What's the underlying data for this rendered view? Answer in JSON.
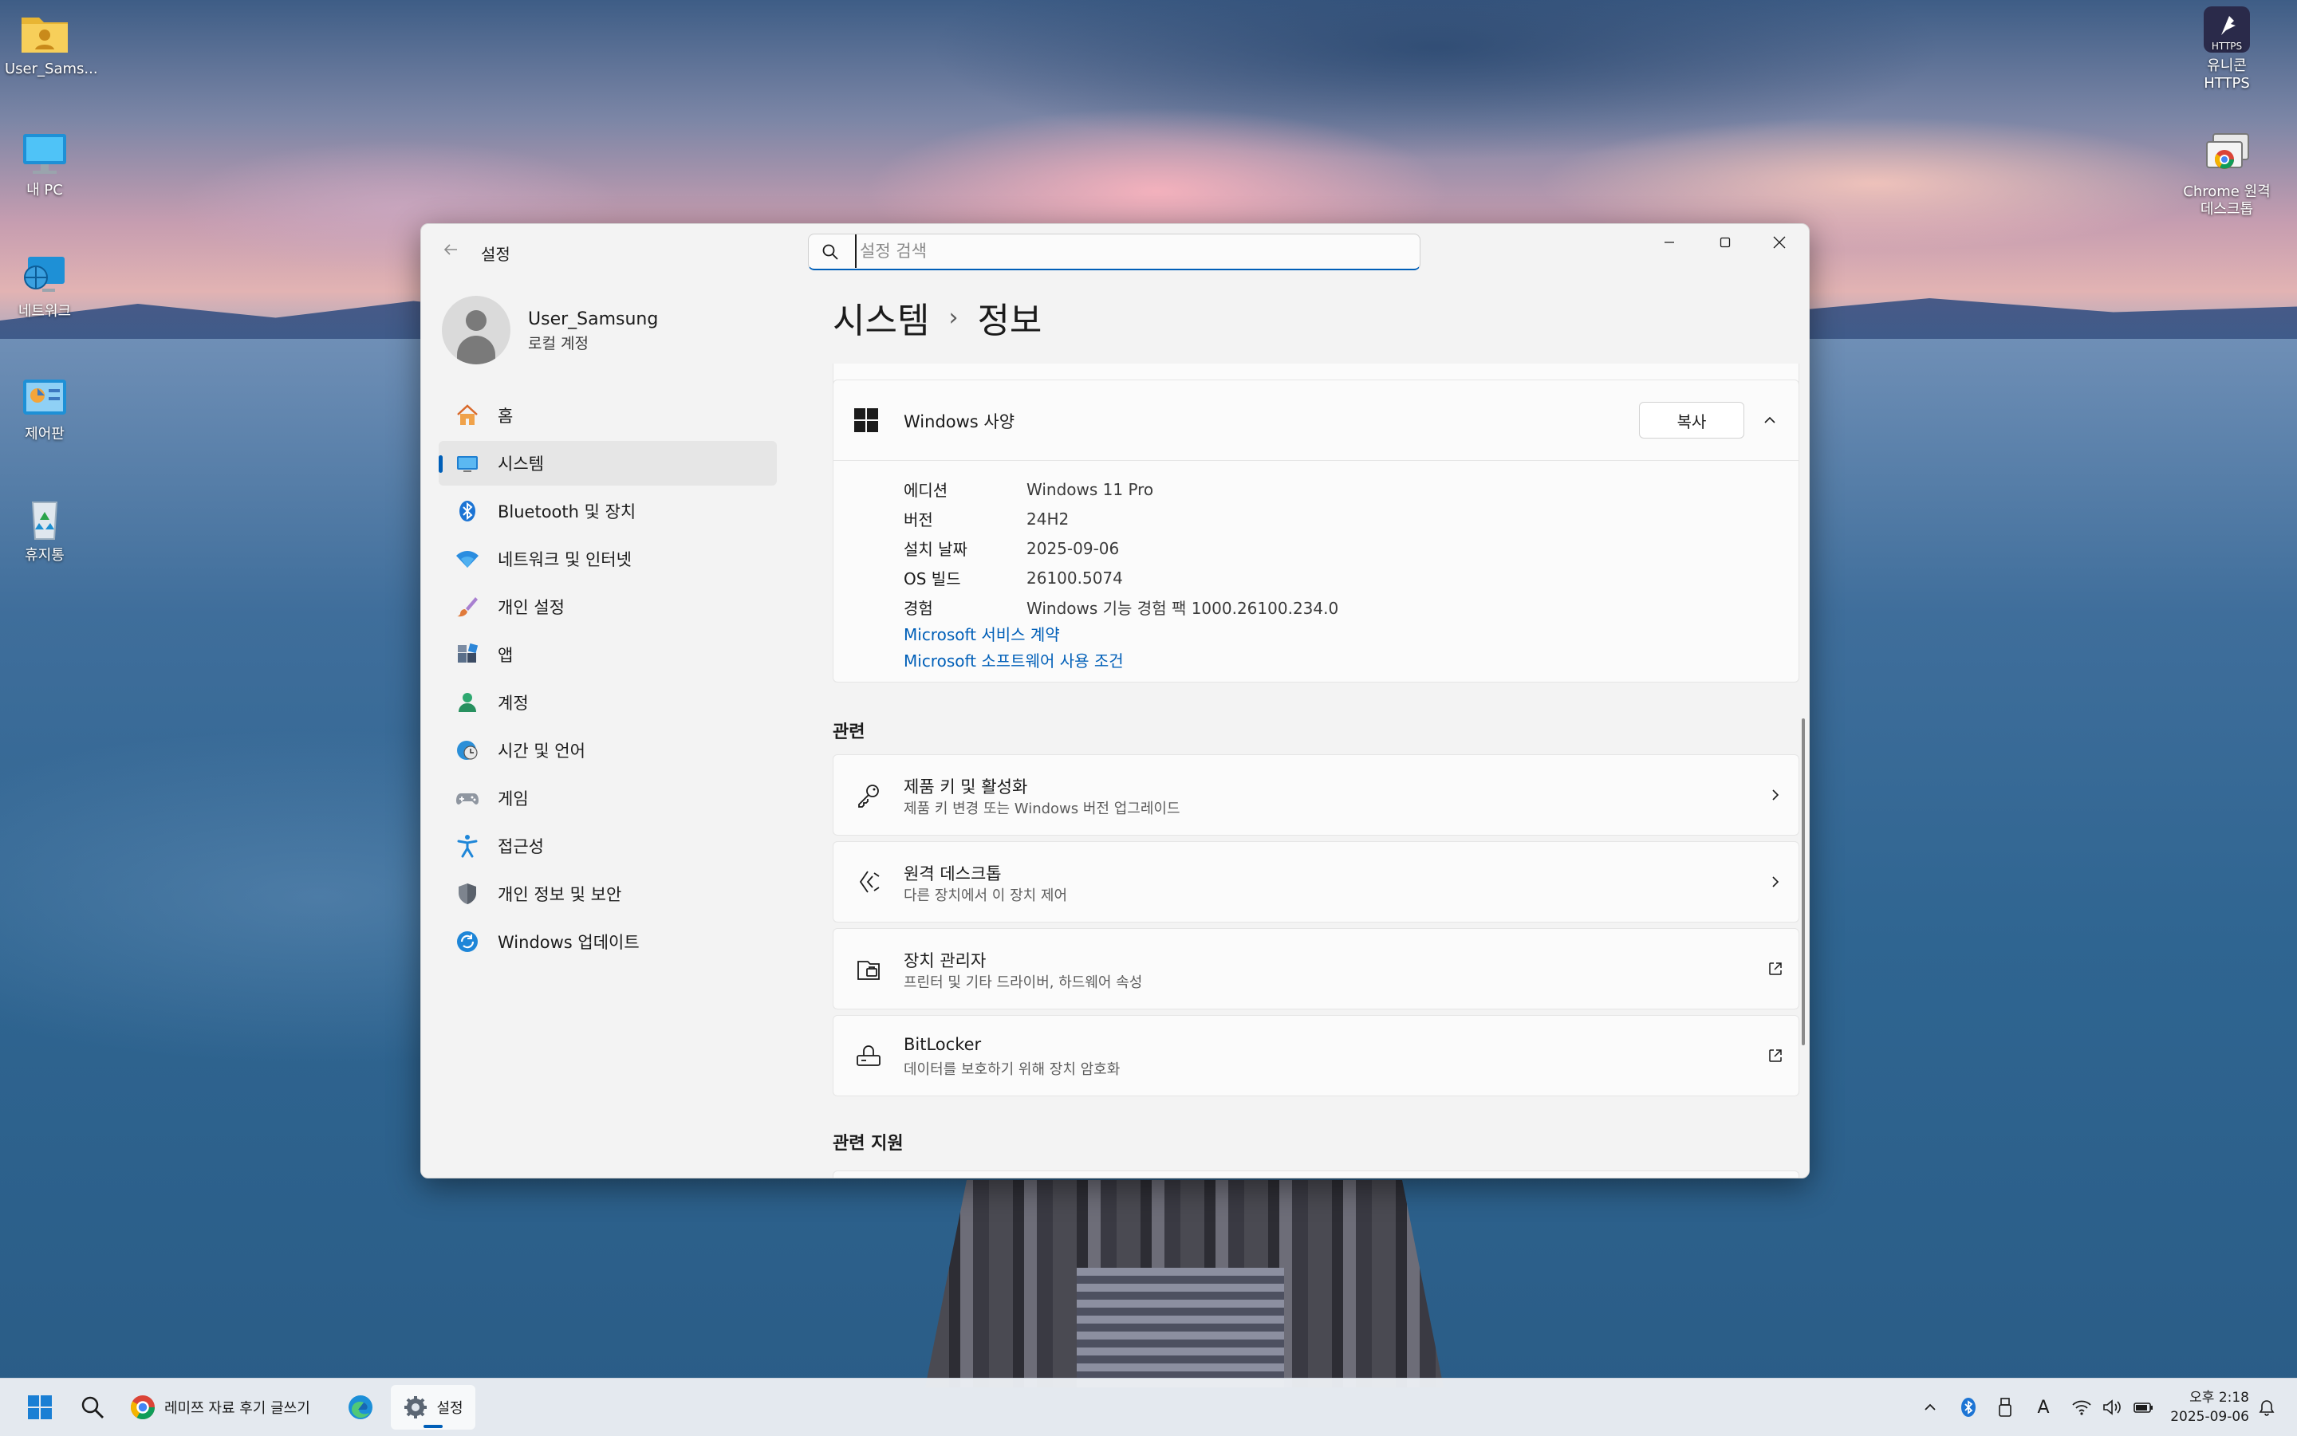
{
  "desktop": {
    "icons_left": [
      {
        "label": "User_Sams..."
      },
      {
        "label": "내 PC"
      },
      {
        "label": "네트워크"
      },
      {
        "label": "제어판"
      },
      {
        "label": "휴지통"
      }
    ],
    "icons_right": [
      {
        "label": "유니콘 HTTPS",
        "badge": "HTTPS"
      },
      {
        "label": "Chrome 원격 데스크톱"
      }
    ]
  },
  "window": {
    "app_title": "설정",
    "search_placeholder": "설정 검색",
    "controls": [
      "minimize",
      "maximize",
      "close"
    ]
  },
  "profile": {
    "name": "User_Samsung",
    "account_type": "로컬 계정"
  },
  "nav": {
    "items": [
      {
        "label": "홈",
        "icon": "home-icon"
      },
      {
        "label": "시스템",
        "icon": "system-icon",
        "selected": true
      },
      {
        "label": "Bluetooth 및 장치",
        "icon": "bluetooth-icon"
      },
      {
        "label": "네트워크 및 인터넷",
        "icon": "wifi-icon"
      },
      {
        "label": "개인 설정",
        "icon": "brush-icon"
      },
      {
        "label": "앱",
        "icon": "apps-icon"
      },
      {
        "label": "계정",
        "icon": "account-icon"
      },
      {
        "label": "시간 및 언어",
        "icon": "time-language-icon"
      },
      {
        "label": "게임",
        "icon": "gamepad-icon"
      },
      {
        "label": "접근성",
        "icon": "accessibility-icon"
      },
      {
        "label": "개인 정보 및 보안",
        "icon": "shield-icon"
      },
      {
        "label": "Windows 업데이트",
        "icon": "update-icon"
      }
    ]
  },
  "breadcrumb": {
    "parent": "시스템",
    "separator": "›",
    "current": "정보"
  },
  "windows_spec": {
    "title": "Windows 사양",
    "copy_label": "복사",
    "rows": [
      {
        "key": "에디션",
        "value": "Windows 11 Pro"
      },
      {
        "key": "버전",
        "value": "24H2"
      },
      {
        "key": "설치 날짜",
        "value": "2025-09-06"
      },
      {
        "key": "OS 빌드",
        "value": "26100.5074"
      },
      {
        "key": "경험",
        "value": "Windows 기능 경험 팩 1000.26100.234.0"
      }
    ],
    "links": [
      "Microsoft 서비스 계약",
      "Microsoft 소프트웨어 사용 조건"
    ]
  },
  "related": {
    "title": "관련",
    "items": [
      {
        "title": "제품 키 및 활성화",
        "subtitle": "제품 키 변경 또는 Windows 버전 업그레이드",
        "icon": "key-icon",
        "action": "chevron"
      },
      {
        "title": "원격 데스크톱",
        "subtitle": "다른 장치에서 이 장치 제어",
        "icon": "remote-desktop-icon",
        "action": "chevron"
      },
      {
        "title": "장치 관리자",
        "subtitle": "프린터 및 기타 드라이버, 하드웨어 속성",
        "icon": "device-manager-icon",
        "action": "external"
      },
      {
        "title": "BitLocker",
        "subtitle": "데이터를 보호하기 위해 장치 암호화",
        "icon": "bitlocker-icon",
        "action": "external"
      }
    ]
  },
  "related_support": {
    "title": "관련 지원"
  },
  "taskbar": {
    "chrome_label": "레미쯔 자료 후기 글쓰기",
    "settings_label": "설정",
    "time": "오후 2:18",
    "date": "2025-09-06",
    "input_indicator": "A"
  },
  "colors": {
    "accent": "#005fb8",
    "window_bg": "#f3f3f3",
    "card_bg": "#fbfbfb"
  }
}
